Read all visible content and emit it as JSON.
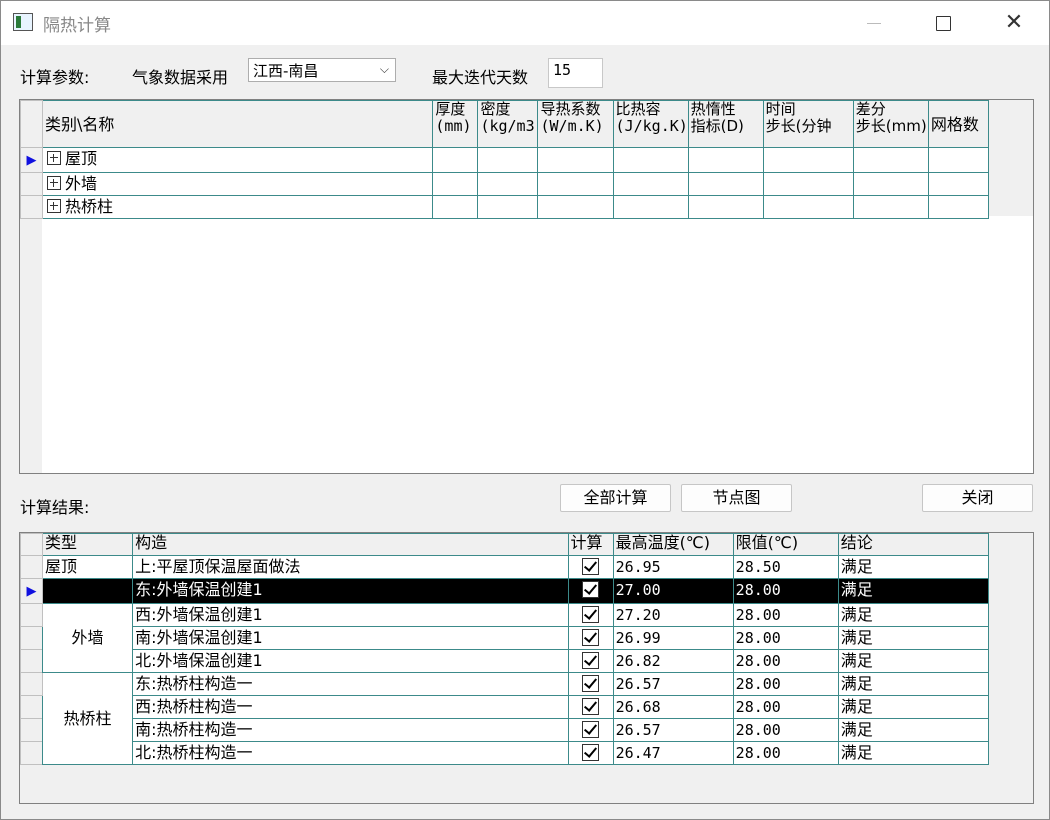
{
  "window": {
    "title": "隔热计算"
  },
  "params": {
    "label": "计算参数:",
    "weather_label": "气象数据采用",
    "weather_value": "江西-南昌",
    "max_days_label": "最大迭代天数",
    "max_days_value": "15"
  },
  "materials": {
    "headers": {
      "name": "类别\\名称",
      "thickness_1": "厚度",
      "thickness_2": "(mm)",
      "density_1": "密度",
      "density_2": "(kg/m3",
      "conductivity_1": "导热系数",
      "conductivity_2": "(W/m.K)",
      "specific_heat_1": "比热容",
      "specific_heat_2": "(J/kg.K)",
      "inertia_1": "热惰性",
      "inertia_2": "指标(D)",
      "time_step_1": "时间",
      "time_step_2": "步长(分钟",
      "diff_step_1": "差分",
      "diff_step_2": "步长(mm)",
      "grid_count": "网格数"
    },
    "rows": [
      "屋顶",
      "外墙",
      "热桥柱"
    ]
  },
  "results": {
    "label": "计算结果:",
    "headers": {
      "type": "类型",
      "construction": "构造",
      "compute": "计算",
      "max_temp": "最高温度(℃)",
      "limit": "限值(℃)",
      "conclusion": "结论"
    },
    "groups": {
      "roof": "屋顶",
      "wall": "外墙",
      "bridge": "热桥柱"
    },
    "rows": [
      {
        "construction": "上:平屋顶保温屋面做法",
        "max_temp": "26.95",
        "limit": "28.50",
        "conclusion": "满足"
      },
      {
        "construction": "东:外墙保温创建1",
        "max_temp": "27.00",
        "limit": "28.00",
        "conclusion": "满足"
      },
      {
        "construction": "西:外墙保温创建1",
        "max_temp": "27.20",
        "limit": "28.00",
        "conclusion": "满足"
      },
      {
        "construction": "南:外墙保温创建1",
        "max_temp": "26.99",
        "limit": "28.00",
        "conclusion": "满足"
      },
      {
        "construction": "北:外墙保温创建1",
        "max_temp": "26.82",
        "limit": "28.00",
        "conclusion": "满足"
      },
      {
        "construction": "东:热桥柱构造一",
        "max_temp": "26.57",
        "limit": "28.00",
        "conclusion": "满足"
      },
      {
        "construction": "西:热桥柱构造一",
        "max_temp": "26.68",
        "limit": "28.00",
        "conclusion": "满足"
      },
      {
        "construction": "南:热桥柱构造一",
        "max_temp": "26.57",
        "limit": "28.00",
        "conclusion": "满足"
      },
      {
        "construction": "北:热桥柱构造一",
        "max_temp": "26.47",
        "limit": "28.00",
        "conclusion": "满足"
      }
    ]
  },
  "buttons": {
    "compute_all": "全部计算",
    "node_chart": "节点图",
    "close": "关闭"
  },
  "colors": {
    "grid_line": "#3c8a8a",
    "selection": "#000000",
    "row_pointer": "#1010e0"
  }
}
